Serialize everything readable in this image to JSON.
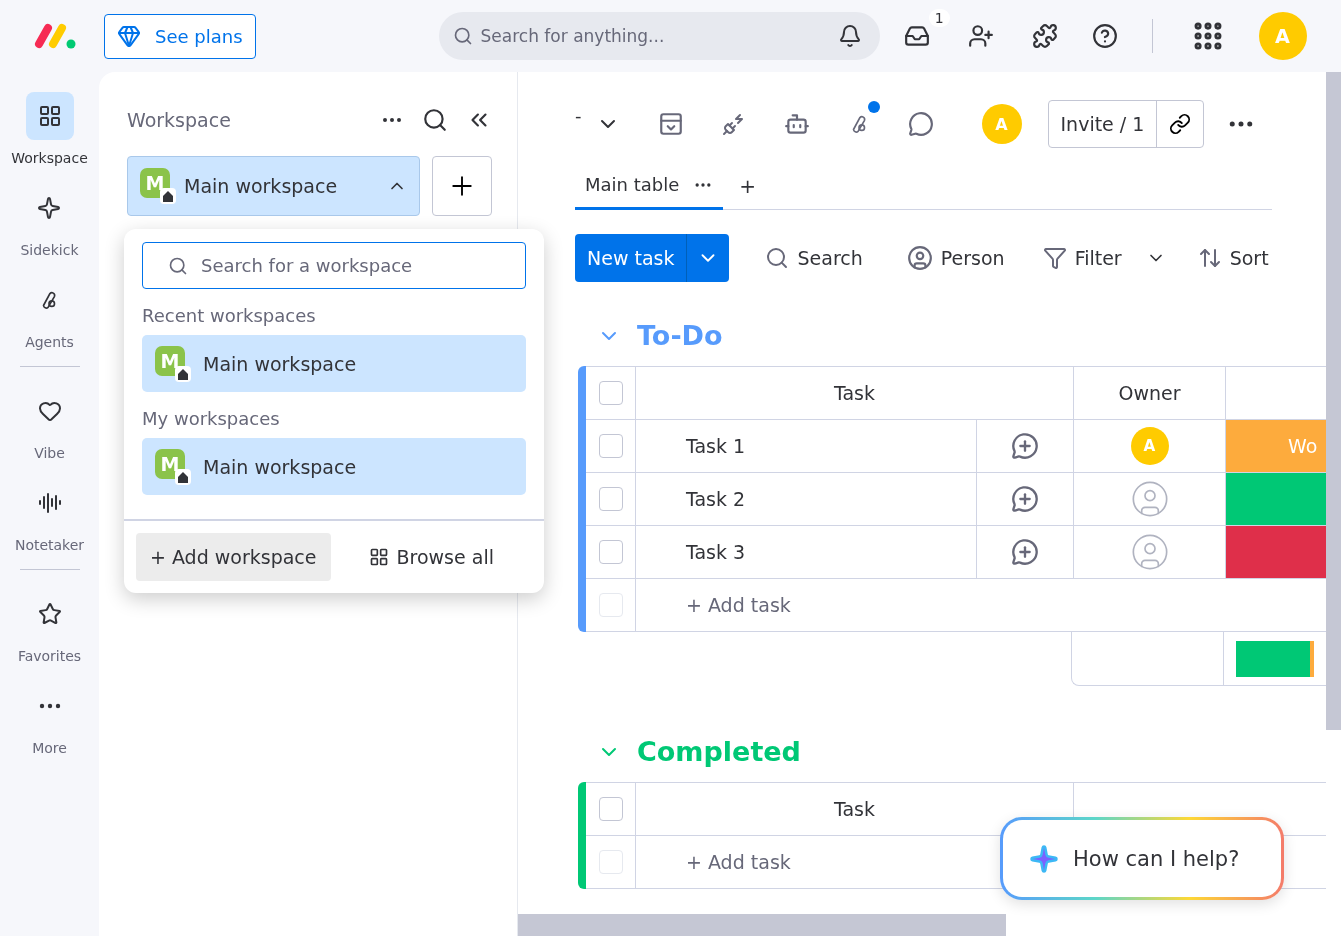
{
  "topbar": {
    "plans_button": "See plans",
    "search": {
      "placeholder": "Search for anything..."
    },
    "inbox_badge": "1",
    "avatar": "A"
  },
  "rail": {
    "groups": [
      [
        {
          "label": "Workspace",
          "selected": true
        },
        {
          "label": "Sidekick",
          "selected": false
        },
        {
          "label": "Agents",
          "selected": false
        }
      ],
      [
        {
          "label": "Vibe",
          "selected": false
        },
        {
          "label": "Notetaker",
          "selected": false
        }
      ],
      [
        {
          "label": "Favorites",
          "selected": false
        },
        {
          "label": "More",
          "selected": false
        }
      ]
    ]
  },
  "panel": {
    "title": "Workspace",
    "current": {
      "name": "Main workspace",
      "initial": "M",
      "expanded": true
    },
    "dropdown": {
      "search": {
        "placeholder": "Search for a workspace"
      },
      "sections": [
        {
          "title": "Recent workspaces",
          "items": [
            {
              "name": "Main workspace",
              "initial": "M",
              "selected": true
            }
          ]
        },
        {
          "title": "My workspaces",
          "items": [
            {
              "name": "Main workspace",
              "initial": "M",
              "selected": true
            }
          ]
        }
      ],
      "add_button": "+ Add workspace",
      "browse_button": "Browse all"
    }
  },
  "board": {
    "title": "-",
    "notification_dot": true,
    "avatar": "A",
    "invite_button": "Invite / 1",
    "tabs": [
      {
        "label": "Main table",
        "selected": true
      }
    ],
    "add_tab": "+",
    "actions": {
      "new_task": "New task",
      "search": "Search",
      "person": "Person",
      "filter": "Filter",
      "sort": "Sort"
    },
    "groups": [
      {
        "title": "To-Do",
        "color": "#579bfc",
        "header_checked": false,
        "columns": [
          "Task",
          "Owner"
        ],
        "rows": [
          {
            "name": "Task 1",
            "checked": false,
            "owner": "A",
            "status": {
              "label": "Wo",
              "color": "#fdab3d"
            }
          },
          {
            "name": "Task 2",
            "checked": false,
            "status": {
              "color": "#00c875"
            }
          },
          {
            "name": "Task 3",
            "checked": false,
            "status": {
              "color": "#df2f4a"
            }
          }
        ],
        "add_row": "+ Add task",
        "add_row_checked": false,
        "summary": true
      },
      {
        "title": "Completed",
        "color": "#00c875",
        "header_checked": false,
        "columns": [
          "Task"
        ],
        "add_row": "+ Add task",
        "add_row_checked": false
      }
    ]
  },
  "assistant": {
    "prompt": "How can I help?"
  }
}
